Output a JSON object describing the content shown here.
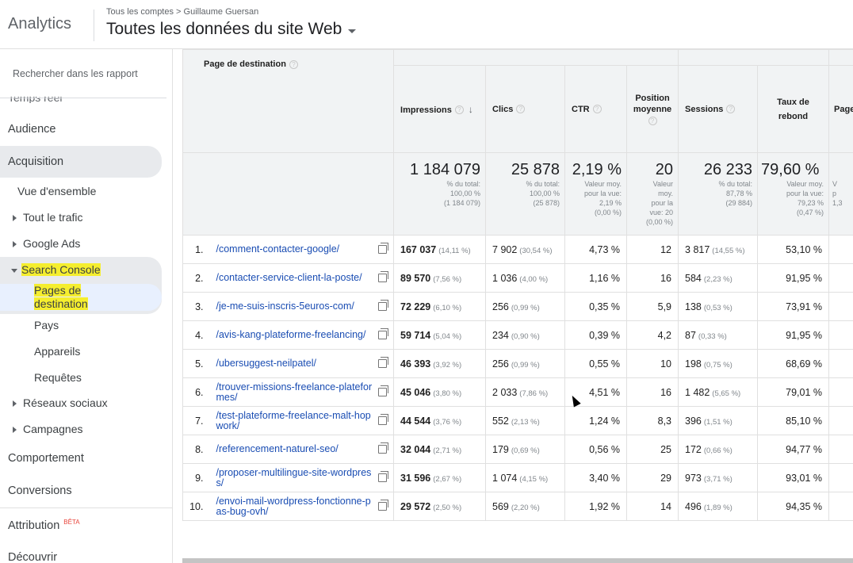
{
  "header": {
    "brand": "Analytics",
    "breadcrumb": "Tous les comptes > Guillaume Guersan",
    "view_title": "Toutes les données du site Web"
  },
  "sidebar": {
    "search_placeholder": "Rechercher dans les rapport",
    "cut_item": "Temps réel",
    "items": {
      "audience": "Audience",
      "acquisition": "Acquisition",
      "overview": "Vue d'ensemble",
      "all_traffic": "Tout le trafic",
      "google_ads": "Google Ads",
      "search_console": "Search Console",
      "landing_pages": "Pages de destination",
      "countries": "Pays",
      "devices": "Appareils",
      "queries": "Requêtes",
      "social": "Réseaux sociaux",
      "campaigns": "Campagnes",
      "behavior": "Comportement",
      "conversions": "Conversions",
      "attribution": "Attribution",
      "beta": "BÊTA",
      "discover": "Découvrir"
    },
    "highlight_color": "#f5ee2e"
  },
  "table": {
    "headers": {
      "page": "Page de destination",
      "impressions": "Impressions",
      "clicks": "Clics",
      "ctr": "CTR",
      "position": "Position moyenne",
      "sessions": "Sessions",
      "bounce": "Taux de rebond",
      "pages_cut": "Page"
    },
    "totals": {
      "impressions": {
        "value": "1 184 079",
        "l1": "% du total:",
        "l2": "100,00 %",
        "l3": "(1 184 079)"
      },
      "clicks": {
        "value": "25 878",
        "l1": "% du total:",
        "l2": "100,00 %",
        "l3": "(25 878)"
      },
      "ctr": {
        "value": "2,19 %",
        "l1": "Valeur moy.",
        "l2": "pour la vue:",
        "l3": "2,19 %",
        "l4": "(0,00 %)"
      },
      "position": {
        "value": "20",
        "l1": "Valeur",
        "l2": "moy.",
        "l3": "pour la",
        "l4": "vue: 20",
        "l5": "(0,00 %)"
      },
      "sessions": {
        "value": "26 233",
        "l1": "% du total:",
        "l2": "87,78 %",
        "l3": "(29 884)"
      },
      "bounce": {
        "value": "79,60 %",
        "l1": "Valeur moy.",
        "l2": "pour la vue:",
        "l3": "79,23 %",
        "l4": "(0,47 %)"
      },
      "pages_cut": {
        "l1": "V",
        "l2": "p",
        "l3": "1,3"
      }
    },
    "rows": [
      {
        "idx": "1.",
        "page": "/comment-contacter-google/",
        "imp": "167 037",
        "imp_pct": "(14,11 %)",
        "clk": "7 902",
        "clk_pct": "(30,54 %)",
        "ctr": "4,73 %",
        "pos": "12",
        "ses": "3 817",
        "ses_pct": "(14,55 %)",
        "bounce": "53,10 %"
      },
      {
        "idx": "2.",
        "page": "/contacter-service-client-la-poste/",
        "imp": "89 570",
        "imp_pct": "(7,56 %)",
        "clk": "1 036",
        "clk_pct": "(4,00 %)",
        "ctr": "1,16 %",
        "pos": "16",
        "ses": "584",
        "ses_pct": "(2,23 %)",
        "bounce": "91,95 %"
      },
      {
        "idx": "3.",
        "page": "/je-me-suis-inscris-5euros-com/",
        "imp": "72 229",
        "imp_pct": "(6,10 %)",
        "clk": "256",
        "clk_pct": "(0,99 %)",
        "ctr": "0,35 %",
        "pos": "5,9",
        "ses": "138",
        "ses_pct": "(0,53 %)",
        "bounce": "73,91 %"
      },
      {
        "idx": "4.",
        "page": "/avis-kang-plateforme-freelancing/",
        "imp": "59 714",
        "imp_pct": "(5,04 %)",
        "clk": "234",
        "clk_pct": "(0,90 %)",
        "ctr": "0,39 %",
        "pos": "4,2",
        "ses": "87",
        "ses_pct": "(0,33 %)",
        "bounce": "91,95 %"
      },
      {
        "idx": "5.",
        "page": "/ubersuggest-neilpatel/",
        "imp": "46 393",
        "imp_pct": "(3,92 %)",
        "clk": "256",
        "clk_pct": "(0,99 %)",
        "ctr": "0,55 %",
        "pos": "10",
        "ses": "198",
        "ses_pct": "(0,75 %)",
        "bounce": "68,69 %"
      },
      {
        "idx": "6.",
        "page": "/trouver-missions-freelance-plateformes/",
        "imp": "45 046",
        "imp_pct": "(3,80 %)",
        "clk": "2 033",
        "clk_pct": "(7,86 %)",
        "ctr": "4,51 %",
        "pos": "16",
        "ses": "1 482",
        "ses_pct": "(5,65 %)",
        "bounce": "79,01 %"
      },
      {
        "idx": "7.",
        "page": "/test-plateforme-freelance-malt-hopwork/",
        "imp": "44 544",
        "imp_pct": "(3,76 %)",
        "clk": "552",
        "clk_pct": "(2,13 %)",
        "ctr": "1,24 %",
        "pos": "8,3",
        "ses": "396",
        "ses_pct": "(1,51 %)",
        "bounce": "85,10 %"
      },
      {
        "idx": "8.",
        "page": "/referencement-naturel-seo/",
        "imp": "32 044",
        "imp_pct": "(2,71 %)",
        "clk": "179",
        "clk_pct": "(0,69 %)",
        "ctr": "0,56 %",
        "pos": "25",
        "ses": "172",
        "ses_pct": "(0,66 %)",
        "bounce": "94,77 %"
      },
      {
        "idx": "9.",
        "page": "/proposer-multilingue-site-wordpress/",
        "imp": "31 596",
        "imp_pct": "(2,67 %)",
        "clk": "1 074",
        "clk_pct": "(4,15 %)",
        "ctr": "3,40 %",
        "pos": "29",
        "ses": "973",
        "ses_pct": "(3,71 %)",
        "bounce": "93,01 %"
      },
      {
        "idx": "10.",
        "page": "/envoi-mail-wordpress-fonctionne-pas-bug-ovh/",
        "imp": "29 572",
        "imp_pct": "(2,50 %)",
        "clk": "569",
        "clk_pct": "(2,20 %)",
        "ctr": "1,92 %",
        "pos": "14",
        "ses": "496",
        "ses_pct": "(1,89 %)",
        "bounce": "94,35 %"
      }
    ]
  }
}
